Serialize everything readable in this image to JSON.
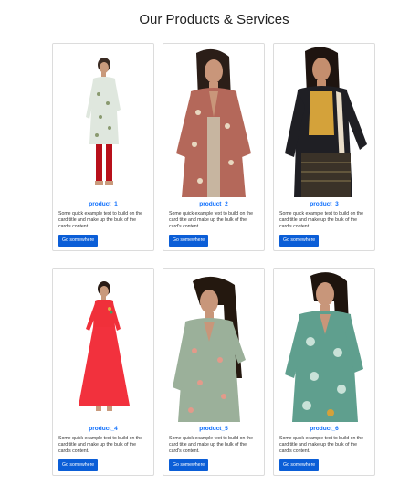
{
  "page": {
    "heading": "Our Products & Services"
  },
  "products": [
    {
      "title": "product_1",
      "text": "Some quick example text to build on the card title and make up the bulk of the card's content.",
      "button": "Go somewhere",
      "image": "woman-in-light-green-kurta"
    },
    {
      "title": "product_2",
      "text": "Some quick example text to build on the card title and make up the bulk of the card's content.",
      "button": "Go somewhere",
      "image": "woman-in-red-printed-kurta"
    },
    {
      "title": "product_3",
      "text": "Some quick example text to build on the card title and make up the bulk of the card's content.",
      "button": "Go somewhere",
      "image": "woman-in-black-mustard-kurta"
    },
    {
      "title": "product_4",
      "text": "Some quick example text to build on the card title and make up the bulk of the card's content.",
      "button": "Go somewhere",
      "image": "woman-in-red-anarkali-kurta"
    },
    {
      "title": "product_5",
      "text": "Some quick example text to build on the card title and make up the bulk of the card's content.",
      "button": "Go somewhere",
      "image": "woman-in-sage-green-kurta"
    },
    {
      "title": "product_6",
      "text": "Some quick example text to build on the card title and make up the bulk of the card's content.",
      "button": "Go somewhere",
      "image": "woman-in-teal-floral-kurta"
    }
  ],
  "colors": {
    "title_link": "#0d6efd",
    "button_bg": "#0b5ed7",
    "card_border": "#dcdcdc"
  }
}
